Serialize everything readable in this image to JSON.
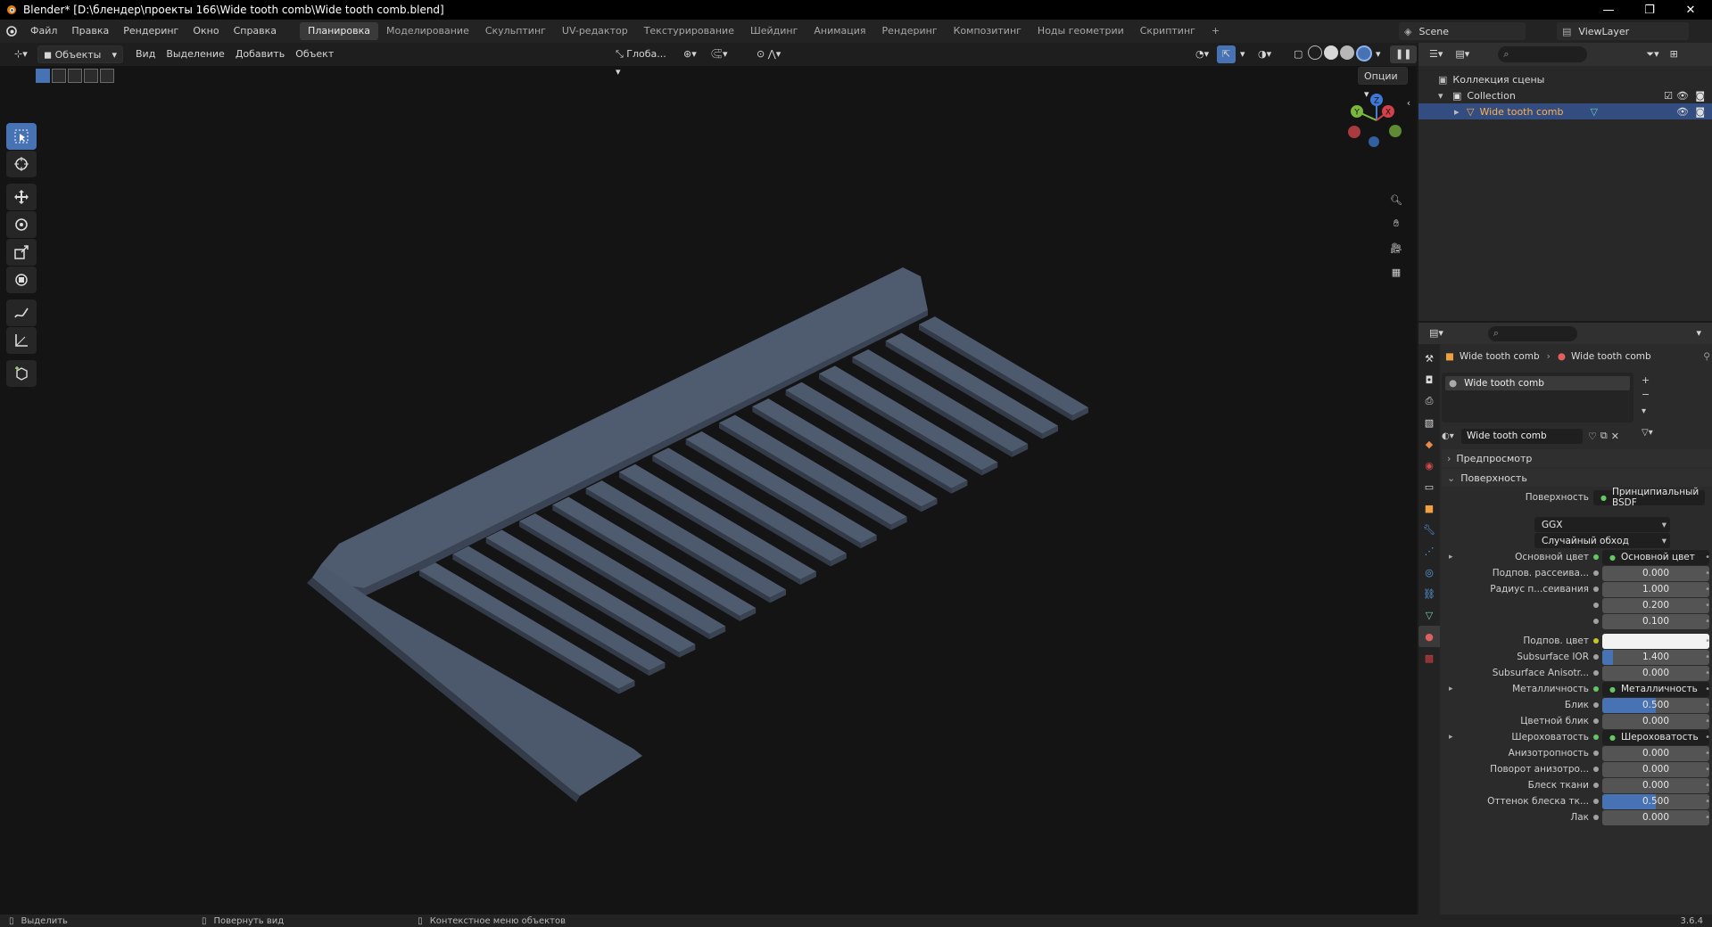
{
  "window": {
    "title": "Blender* [D:\\блендер\\проекты 166\\Wide tooth comb\\Wide tooth comb.blend]",
    "controls": [
      "—",
      "❐",
      "✕"
    ]
  },
  "menubar": {
    "menus": [
      "Файл",
      "Правка",
      "Рендеринг",
      "Окно",
      "Справка"
    ],
    "workspaces": [
      "Планировка",
      "Моделирование",
      "Скульптинг",
      "UV-редактор",
      "Текстурирование",
      "Шейдинг",
      "Анимация",
      "Рендеринг",
      "Композитинг",
      "Ноды геометрии",
      "Скриптинг"
    ],
    "active_workspace": "Планировка",
    "add_tab": "+",
    "scene": "Scene",
    "view_layer": "ViewLayer"
  },
  "viewport_header": {
    "mode": "Объекты",
    "menus": [
      "Вид",
      "Выделение",
      "Добавить",
      "Объект"
    ],
    "orientation": "Глоба...",
    "options": "Опции"
  },
  "gizmo": {
    "z": "Z",
    "y": "Y",
    "x": "X"
  },
  "outliner": {
    "items": [
      {
        "label": "Коллекция сцены"
      },
      {
        "label": "Collection"
      },
      {
        "label": "Wide tooth comb"
      }
    ]
  },
  "properties": {
    "breadcrumb_object": "Wide tooth comb",
    "breadcrumb_material": "Wide tooth comb",
    "slot_name": "Wide tooth comb",
    "material_name": "Wide tooth comb",
    "sections": {
      "preview": "Предпросмотр",
      "surface": "Поверхность"
    },
    "surface_label": "Поверхность",
    "surface_value": "Принципиальный BSDF",
    "distribution": "GGX",
    "subsurface_method": "Случайный обход",
    "rows": [
      {
        "label": "Основной цвет",
        "value": "Основной цвет",
        "kind": "link"
      },
      {
        "label": "Подпов. рассеива...",
        "value": "0.000",
        "kind": "num"
      },
      {
        "label": "Радиус п...сеивания",
        "value": "1.000",
        "kind": "num"
      },
      {
        "label": "",
        "value": "0.200",
        "kind": "num"
      },
      {
        "label": "",
        "value": "0.100",
        "kind": "num"
      },
      {
        "label": "Подпов. цвет",
        "value": "",
        "kind": "color"
      },
      {
        "label": "Subsurface IOR",
        "value": "1.400",
        "kind": "num",
        "fill": 0.1
      },
      {
        "label": "Subsurface Anisotr...",
        "value": "0.000",
        "kind": "num"
      },
      {
        "label": "Металличность",
        "value": "Металличность",
        "kind": "link"
      },
      {
        "label": "Блик",
        "value": "0.500",
        "kind": "num",
        "fill": 0.5
      },
      {
        "label": "Цветной блик",
        "value": "0.000",
        "kind": "num"
      },
      {
        "label": "Шероховатость",
        "value": "Шероховатость",
        "kind": "link"
      },
      {
        "label": "Анизотропность",
        "value": "0.000",
        "kind": "num"
      },
      {
        "label": "Поворот анизотро...",
        "value": "0.000",
        "kind": "num"
      },
      {
        "label": "Блеск ткани",
        "value": "0.000",
        "kind": "num"
      },
      {
        "label": "Оттенок блеска тк...",
        "value": "0.500",
        "kind": "num",
        "fill": 0.5
      },
      {
        "label": "Лак",
        "value": "0.000",
        "kind": "num"
      }
    ]
  },
  "statusbar": {
    "select": "Выделить",
    "rotate": "Повернуть вид",
    "context": "Контекстное меню объектов",
    "version": "3.6.4"
  },
  "colors": {
    "accent": "#4772b3",
    "comb": "#4f5d73",
    "selected_text": "#ffb04a"
  }
}
